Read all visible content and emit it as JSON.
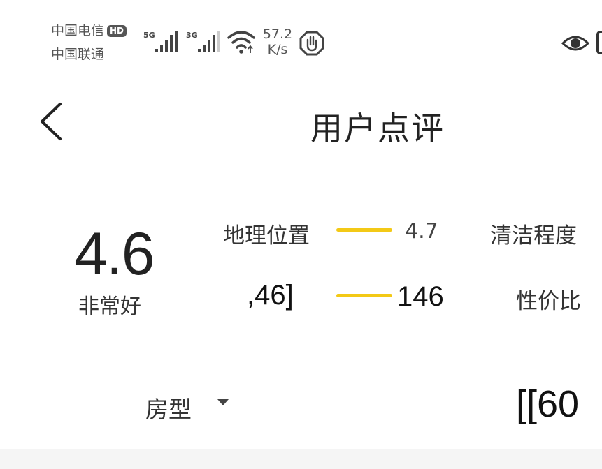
{
  "status_bar": {
    "carrier1": "中国电信",
    "hd_badge": "HD",
    "carrier2": "中国联通",
    "signal1_type": "5G",
    "signal2_type": "3G",
    "speed_value": "57.2",
    "speed_unit": "K/s"
  },
  "header": {
    "title": "用户点评"
  },
  "score": {
    "value": "4.6",
    "label": "非常好"
  },
  "sub_scores": {
    "location": {
      "label": "地理位置",
      "value": "4.7"
    },
    "cleanliness": {
      "label": "清洁程度"
    },
    "row2_left": ",46]",
    "row2_value": "146",
    "value_for_money": {
      "label": "性价比"
    }
  },
  "filter": {
    "room_type_label": "房型",
    "right_value": "[[60"
  },
  "colors": {
    "accent_bar": "#f3c916"
  }
}
